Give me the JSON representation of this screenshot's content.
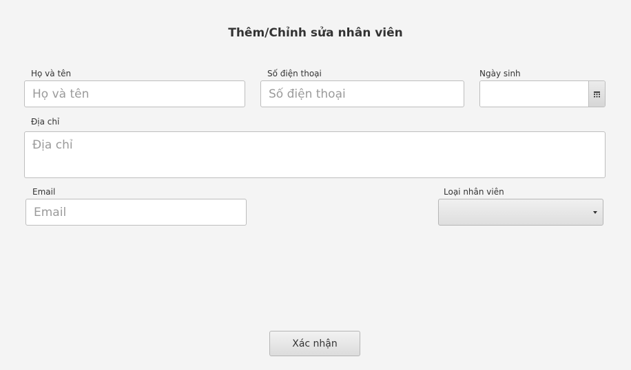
{
  "form": {
    "title": "Thêm/Chỉnh sửa nhân viên",
    "full_name": {
      "label": "Họ và tên",
      "placeholder": "Họ và tên",
      "value": ""
    },
    "phone": {
      "label": "Số điện thoại",
      "placeholder": "Số điện thoại",
      "value": ""
    },
    "birth_date": {
      "label": "Ngày sinh",
      "value": "",
      "icon": "calendar-icon"
    },
    "address": {
      "label": "Địa chỉ",
      "placeholder": "Địa chỉ",
      "value": ""
    },
    "email": {
      "label": "Email",
      "placeholder": "Email",
      "value": ""
    },
    "employee_type": {
      "label": "Loại nhân viên",
      "selected": "",
      "icon": "chevron-down-icon"
    },
    "submit_label": "Xác nhận"
  }
}
